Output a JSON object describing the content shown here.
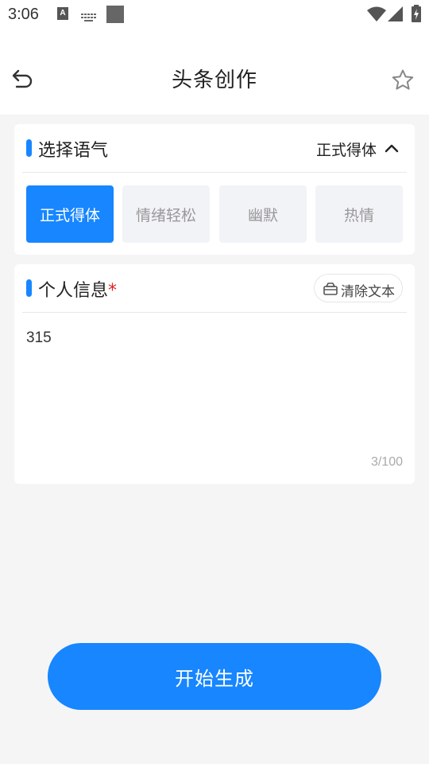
{
  "status_bar": {
    "time": "3:06",
    "badge_letter": "A",
    "icons": [
      "keyboard-icon",
      "square-icon",
      "wifi-icon",
      "signal-icon",
      "battery-charging-icon"
    ]
  },
  "header": {
    "title": "头条创作",
    "back_icon": "undo-arrow-icon",
    "favorite_icon": "star-outline-icon"
  },
  "tone_section": {
    "title": "选择语气",
    "current": "正式得体",
    "options": [
      {
        "label": "正式得体",
        "selected": true
      },
      {
        "label": "情绪轻松",
        "selected": false
      },
      {
        "label": "幽默",
        "selected": false
      },
      {
        "label": "热情",
        "selected": false
      }
    ]
  },
  "info_section": {
    "title": "个人信息",
    "required_mark": "*",
    "clear_label": "清除文本",
    "input_value": "315",
    "char_count": "3/100"
  },
  "actions": {
    "generate_label": "开始生成"
  },
  "colors": {
    "accent": "#1786ff",
    "required": "#e02020",
    "background": "#f5f5f5"
  }
}
